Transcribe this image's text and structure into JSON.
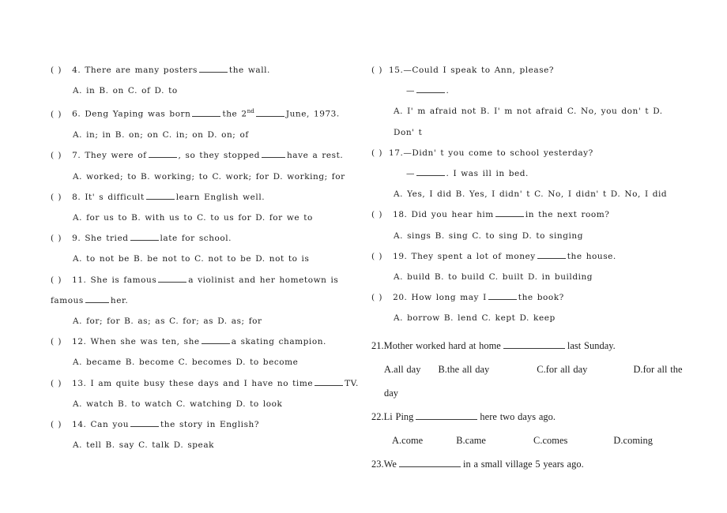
{
  "document": {
    "type": "english-grammar-worksheet",
    "columns": 2
  },
  "left_column": {
    "items": [
      {
        "marker": "(    )",
        "number": "4.",
        "stem_before": "There are many posters",
        "stem_after": "the wall.",
        "options_line": "A.  in            B.  on              C.  of                  D.  to"
      },
      {
        "marker": "(    )",
        "number": "6.",
        "stem_before": "Deng Yaping was born",
        "stem_mid": "the 2",
        "stem_sup": "nd",
        "stem_after": "June, 1973.",
        "options_line": "A.  in; in     B.  on; on          C.  in; on        D.  on; of"
      },
      {
        "marker": "(    )",
        "number": "7.",
        "stem_before": "They were of",
        "stem_mid": ", so they stopped",
        "stem_after": "have a rest.",
        "options_line": "A.  worked; to   B.  working; to   C.  work; for   D.  working; for"
      },
      {
        "marker": "(    )",
        "number": "8.",
        "stem_before": "It'  s difficult",
        "stem_after": "learn English well.",
        "options_line": "A.  for us to   B.  with us to   C.  to us for   D.  for we to"
      },
      {
        "marker": "(    )",
        "number": "9.",
        "stem_before": "She tried",
        "stem_after": "late for school.",
        "options_line": "A.  to not be   B.  be not to   C.  not to be   D.  not to is"
      },
      {
        "marker": "(    )",
        "number": "11.",
        "stem_before": "She is famous",
        "stem_mid": "a violinist and her hometown is famous",
        "stem_after": "her.",
        "options_line": "A.  for; for     B.  as; as     C.  for; as     D.  as; for"
      },
      {
        "marker": "(    )",
        "number": "12.",
        "stem_before": "When she was ten, she",
        "stem_after": "a skating champion.",
        "options_line": "A.  became     B.  become     C.  becomes     D.  to become"
      },
      {
        "marker": "(    )",
        "number": "13.",
        "stem_before": "I am quite busy these days and I have no time",
        "stem_after": "TV.",
        "options_line": "A.  watch       B.  to watch     C.  watching    D.  to look"
      },
      {
        "marker": "(    )",
        "number": "14.",
        "stem_before": "Can you",
        "stem_after": "the story in English?",
        "options_line": "A.  tell         B.  say            C.  talk          D.  speak"
      }
    ]
  },
  "right_column": {
    "items": [
      {
        "marker": "(    )",
        "number": "15.",
        "stem": "—Could I speak to Ann, please?",
        "reply_dash": "—",
        "reply_after": ".",
        "options_line": "A.  I'  m afraid not    B.  I'  m not afraid    C.  No, you don'  t    D.  Don'  t"
      },
      {
        "marker": "(    )",
        "number": "17.",
        "stem": "—Didn'  t you come to school yesterday?",
        "reply_dash": "—",
        "reply_after": ". I was ill in bed.",
        "options_line": "A.  Yes, I did        B.  Yes, I didn'  t      C.  No, I didn'  t        D.  No, I did"
      },
      {
        "marker": "(    )",
        "number": "18.",
        "stem_before": "Did you hear him",
        "stem_after": "in the next room?",
        "options_line": "A.  sings   B.  sing   C.  to sing   D.  to singing"
      },
      {
        "marker": "(    )",
        "number": "19.",
        "stem_before": "They spent a lot of money",
        "stem_after": "the house.",
        "options_line": "A.  build        B.  to build         C.  built       D.    in building"
      },
      {
        "marker": "(    )",
        "number": "20.",
        "stem_before": "How long may I",
        "stem_after": "the book?",
        "options_line": "A.  borrow        B.  lend        C.  kept        D.  keep"
      }
    ],
    "serif_items": [
      {
        "number_stem_before": "21.Mother worked hard at home",
        "stem_after": "last Sunday.",
        "opt_a": "A.all day",
        "opt_b": "B.the all day",
        "opt_c": "C.for all day",
        "opt_d": "D.for all the day"
      },
      {
        "number_stem_before": "22.Li Ping",
        "stem_after": "here two days ago.",
        "opt_a": "A.come",
        "opt_b": "B.came",
        "opt_c": "C.comes",
        "opt_d": "D.coming"
      },
      {
        "number_stem_before": "23.We",
        "stem_after": "in a small village 5 years ago.",
        "opt_a": "",
        "opt_b": "",
        "opt_c": "",
        "opt_d": ""
      }
    ]
  }
}
